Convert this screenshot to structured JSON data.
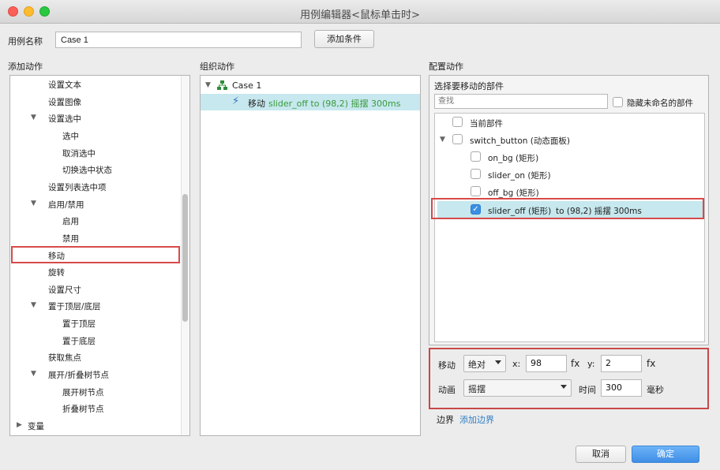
{
  "window": {
    "title": "用例编辑器<鼠标单击时>"
  },
  "case_name": {
    "label": "用例名称",
    "value": "Case 1",
    "add_condition_label": "添加条件"
  },
  "sections": {
    "add_action": "添加动作",
    "organize_action": "组织动作",
    "configure_action": "配置动作"
  },
  "add_actions": [
    {
      "label": "设置文本",
      "level": 1
    },
    {
      "label": "设置图像",
      "level": 1
    },
    {
      "label": "设置选中",
      "level": 1,
      "expanded": true
    },
    {
      "label": "选中",
      "level": 2
    },
    {
      "label": "取消选中",
      "level": 2
    },
    {
      "label": "切换选中状态",
      "level": 2
    },
    {
      "label": "设置列表选中项",
      "level": 1
    },
    {
      "label": "启用/禁用",
      "level": 1,
      "expanded": true
    },
    {
      "label": "启用",
      "level": 2
    },
    {
      "label": "禁用",
      "level": 2
    },
    {
      "label": "移动",
      "level": 1,
      "highlighted": true
    },
    {
      "label": "旋转",
      "level": 1
    },
    {
      "label": "设置尺寸",
      "level": 1
    },
    {
      "label": "置于顶层/底层",
      "level": 1,
      "expanded": true
    },
    {
      "label": "置于顶层",
      "level": 2
    },
    {
      "label": "置于底层",
      "level": 2
    },
    {
      "label": "获取焦点",
      "level": 1
    },
    {
      "label": "展开/折叠树节点",
      "level": 1,
      "expanded": true
    },
    {
      "label": "展开树节点",
      "level": 2
    },
    {
      "label": "折叠树节点",
      "level": 2
    },
    {
      "label": "变量",
      "level": 0,
      "collapsed": true
    }
  ],
  "organize": {
    "case_label": "Case 1",
    "action_verb": "移动",
    "action_detail": "slider_off to (98,2) 摇摆 300ms"
  },
  "config": {
    "select_widget_label": "选择要移动的部件",
    "search_placeholder": "查找",
    "hide_unnamed_label": "隐藏未命名的部件",
    "tree": {
      "current": "当前部件",
      "switch_button": "switch_button (动态面板)",
      "on_bg": "on_bg (矩形)",
      "slider_on": "slider_on (矩形)",
      "off_bg": "off_bg (矩形)",
      "slider_off": "slider_off (矩形)",
      "slider_off_detail": "to (98,2) 摇摆 300ms"
    },
    "move": {
      "label": "移动",
      "mode": "绝对",
      "x_label": "x:",
      "x": "98",
      "y_label": "y:",
      "y": "2",
      "fx": "fx"
    },
    "animation": {
      "label": "动画",
      "type": "摇摆",
      "time_label": "时间",
      "time": "300",
      "unit": "毫秒"
    },
    "border": {
      "label": "边界",
      "link": "添加边界"
    }
  },
  "buttons": {
    "cancel": "取消",
    "ok": "确定"
  },
  "colors": {
    "highlight_red": "#d64a4a",
    "selection_bg": "#c6e8ee",
    "green_text": "#3a9a3a",
    "link_blue": "#2f7fc4",
    "primary_blue": "#4a96ea"
  }
}
